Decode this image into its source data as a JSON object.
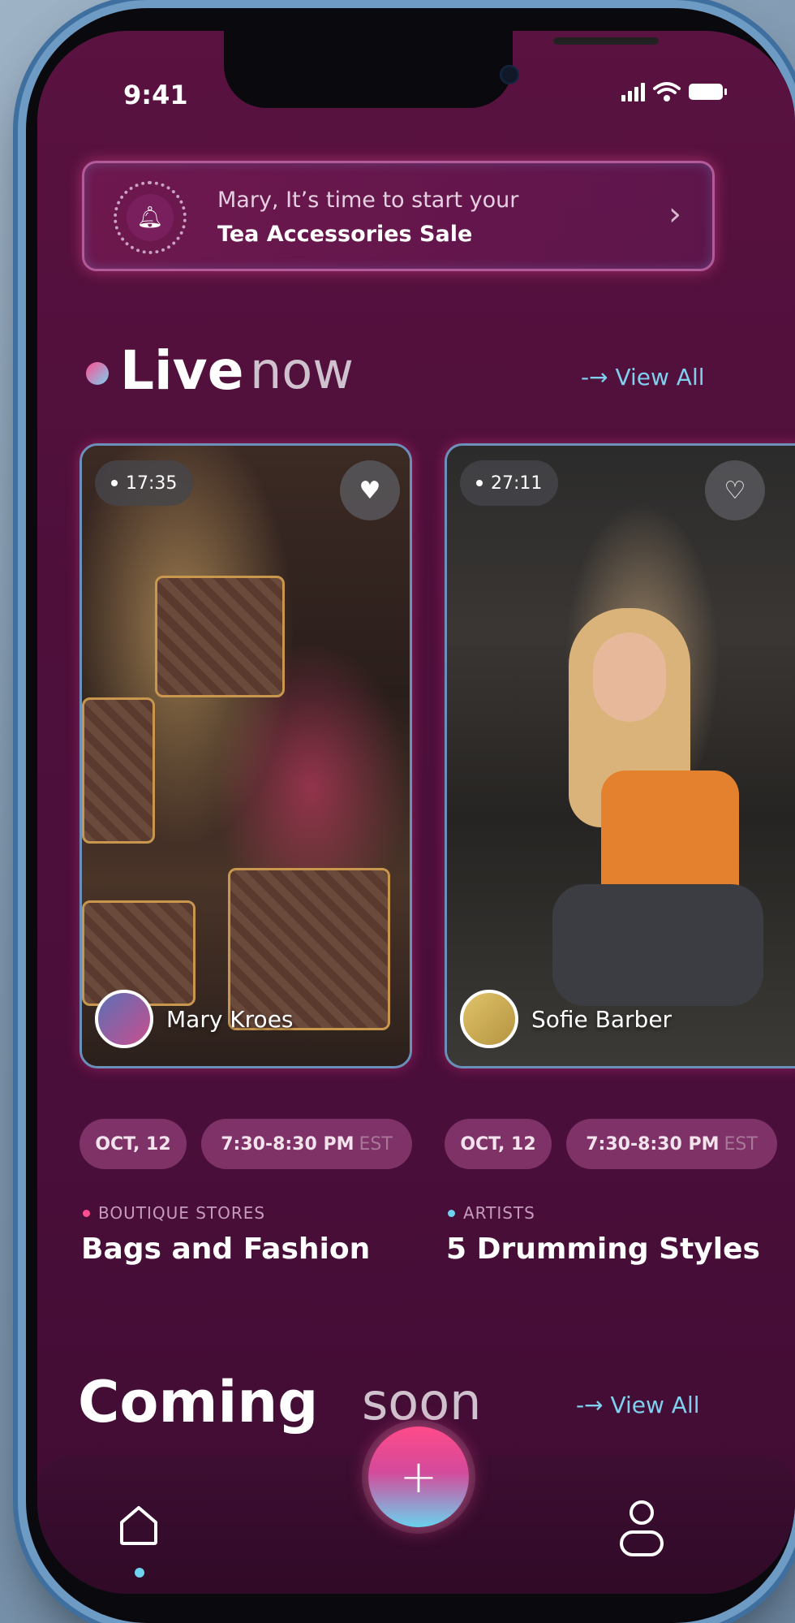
{
  "status_bar": {
    "time": "9:41"
  },
  "banner": {
    "line1": "Mary, It’s time to start your",
    "line2": "Tea Accessories Sale"
  },
  "live_section": {
    "title": "Live",
    "subtitle": "now",
    "view_all": "-→ View All",
    "cards": [
      {
        "timer": "17:35",
        "host": "Mary Kroes",
        "date": "OCT, 12",
        "time": "7:30-8:30 PM",
        "timezone": "EST",
        "category": "BOUTIQUE STORES",
        "category_color": "#ff4d8f",
        "title": "Bags and Fashion",
        "favorited": true
      },
      {
        "timer": "27:11",
        "host": "Sofie Barber",
        "date": "OCT, 12",
        "time": "7:30-8:30 PM",
        "timezone": "EST",
        "category": "ARTISTS",
        "category_color": "#6fd3ef",
        "title": "5 Drumming Styles",
        "favorited": false
      }
    ]
  },
  "coming_section": {
    "title": "Coming",
    "subtitle": "soon",
    "view_all": "-→ View All"
  },
  "nav": {
    "add_label": "+",
    "active": "home"
  },
  "colors": {
    "background": "#4e0f3b",
    "accent_pink": "#ff4b8a",
    "accent_cyan": "#6fd3ef"
  }
}
